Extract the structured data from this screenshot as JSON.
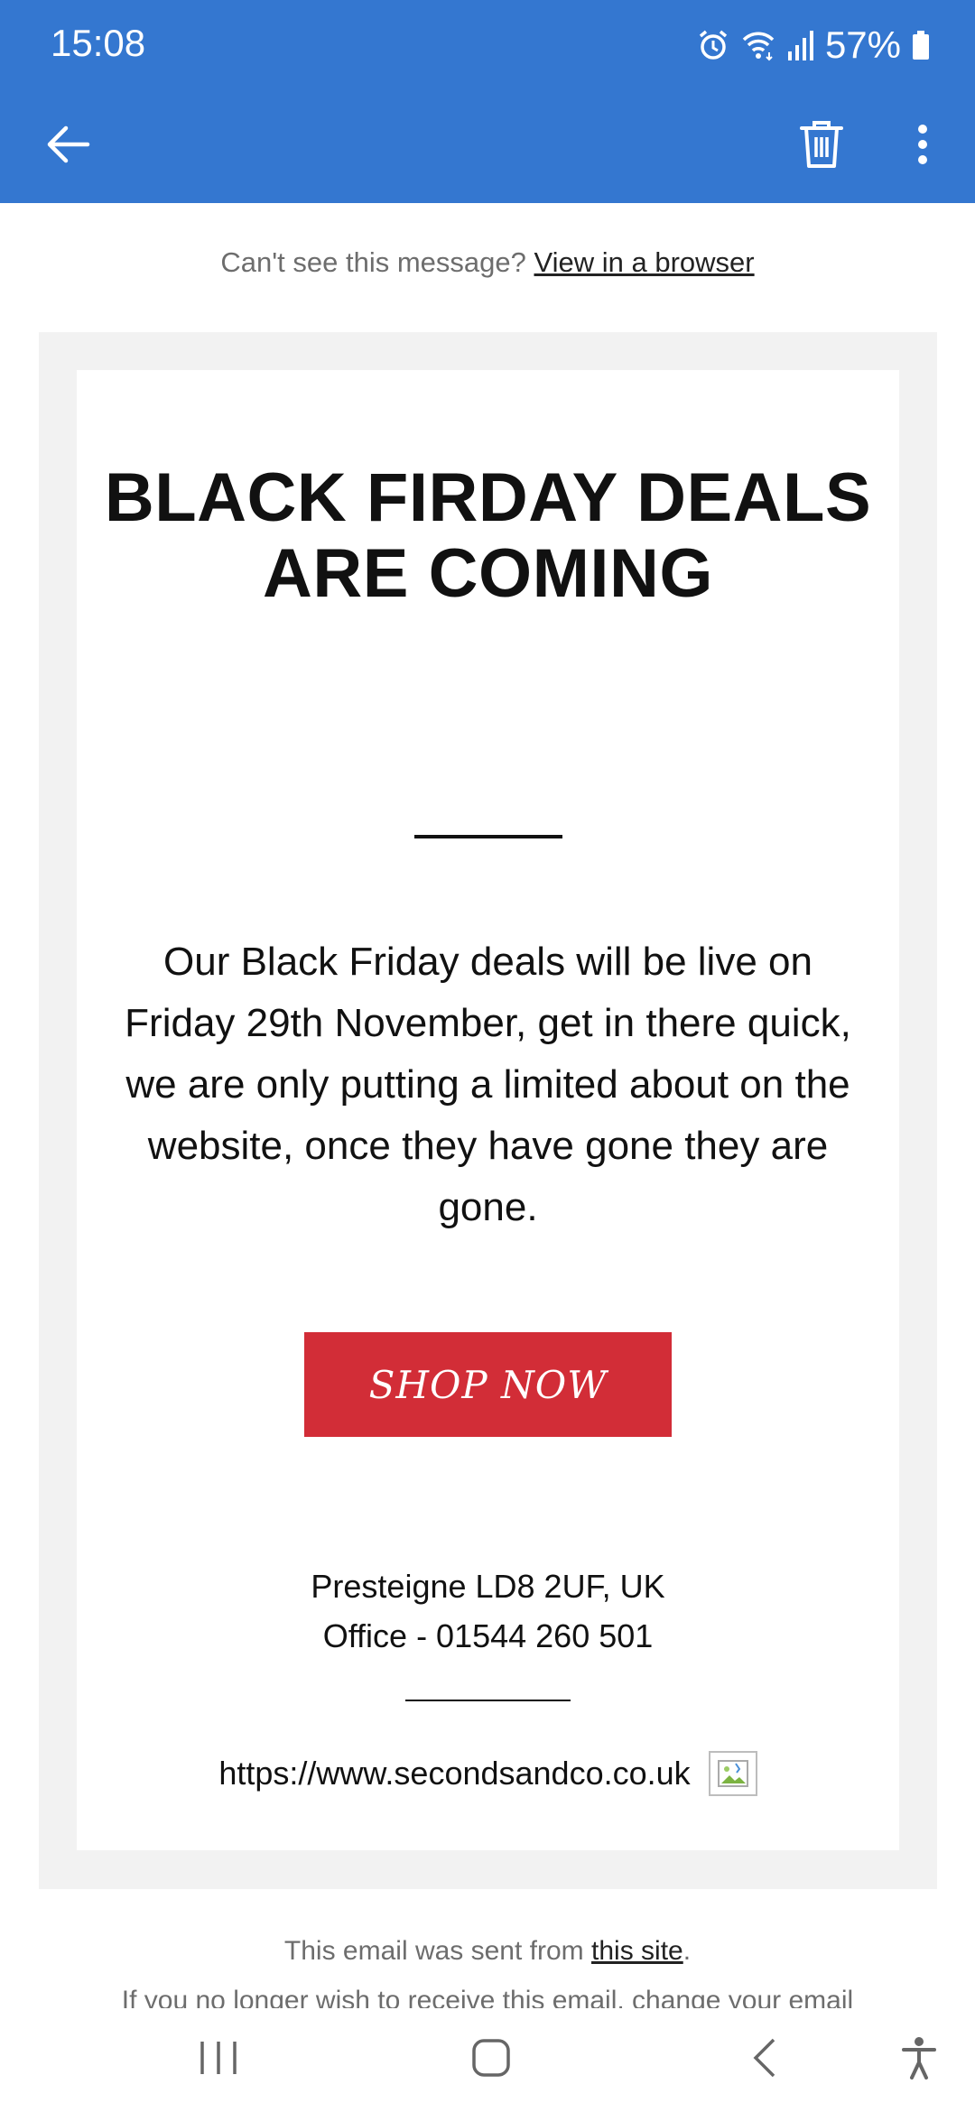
{
  "status_bar": {
    "time": "15:08",
    "battery": "57%",
    "icons": [
      "alarm-icon",
      "wifi-icon",
      "signal-icon",
      "battery-icon"
    ]
  },
  "app_bar": {
    "icons": [
      "back-arrow-icon",
      "trash-icon",
      "more-vert-icon"
    ],
    "color": "#3477d0"
  },
  "email": {
    "preheader_text": "Can't see this message?",
    "preheader_link": "View in a browser",
    "headline": "BLACK FIRDAY DEALS ARE COMING",
    "body": "Our Black Friday deals will be live on Friday 29th November, get in there quick, we are only putting a limited about on the website, once they have gone they are gone.",
    "cta_label": "SHOP NOW",
    "cta_color": "#d22d37",
    "address_line1": "Presteigne LD8 2UF, UK",
    "address_line2": "Office - 01544 260 501",
    "website": "https://www.secondsandco.co.uk",
    "footer_text": "This email was sent from",
    "footer_link": "this site",
    "footer_punct": ".",
    "footer_truncated": "If you no longer wish to receive this email, change your email"
  },
  "nav_bar": {
    "icons": [
      "recents-icon",
      "home-icon",
      "back-icon",
      "accessibility-icon"
    ]
  }
}
